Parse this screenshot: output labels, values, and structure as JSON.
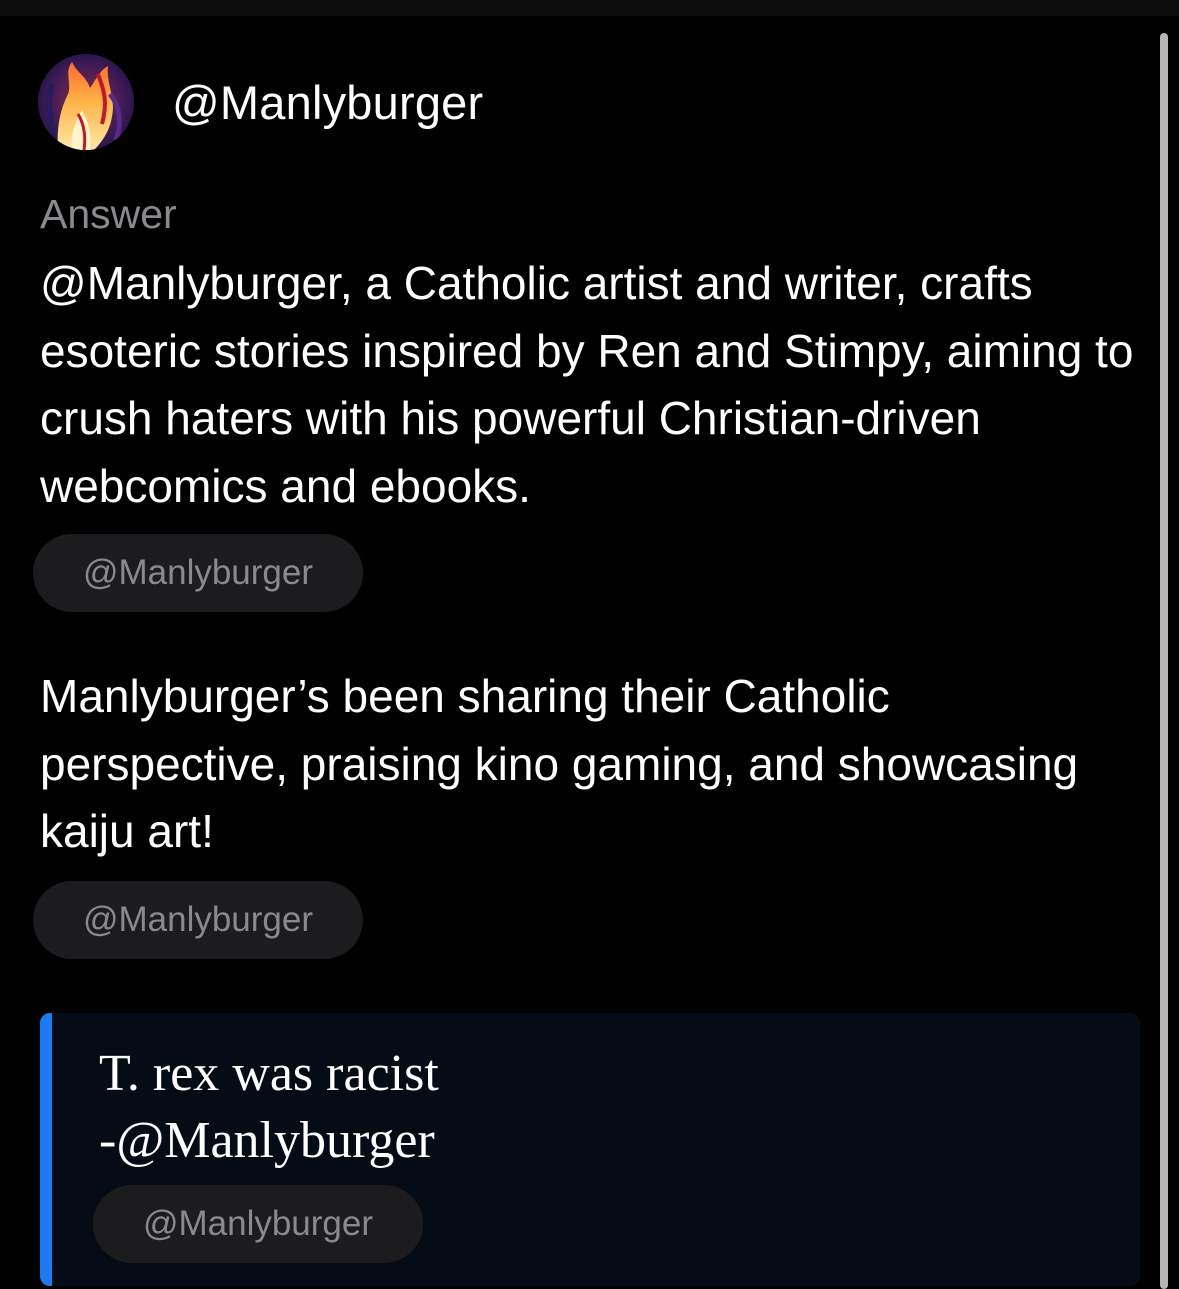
{
  "header": {
    "username": "@Manlyburger",
    "avatar_icon": "flame-artwork-avatar"
  },
  "answer": {
    "label": "Answer",
    "paragraphs": [
      {
        "text": "@Manlyburger, a Catholic artist and writer, crafts esoteric stories inspired by Ren and Stimpy, aiming to crush haters with his powerful Christian-driven webcomics and ebooks.",
        "source_chip": "@Manlyburger"
      },
      {
        "text": "Manlyburger’s been sharing their Catholic perspective, praising kino gaming, and showcasing kaiju art!",
        "source_chip": "@Manlyburger"
      }
    ]
  },
  "quote": {
    "line1": "T. rex was racist",
    "line2": "-@Manlyburger",
    "source_chip": "@Manlyburger"
  },
  "colors": {
    "background": "#000000",
    "text_primary": "#ffffff",
    "text_secondary": "#8a8a8e",
    "chip_background": "#1c1c1e",
    "quote_accent": "#1a7bf2",
    "quote_background": "#050c16"
  }
}
